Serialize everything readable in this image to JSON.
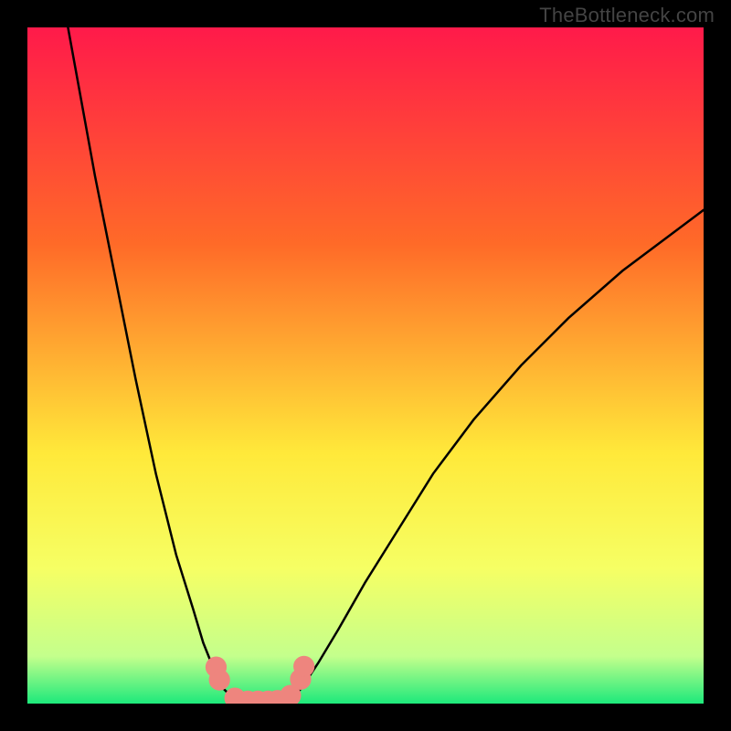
{
  "watermark": "TheBottleneck.com",
  "colors": {
    "bg": "#000000",
    "gradient_top": "#ff1a4a",
    "gradient_upper_mid": "#ff6a28",
    "gradient_mid": "#ffe93a",
    "gradient_lower_mid": "#f6ff64",
    "gradient_near_bottom": "#c4ff8c",
    "gradient_bottom": "#1de97b",
    "curve": "#000000",
    "marker_fill": "#ee857e",
    "marker_stroke": "#ee857e"
  },
  "chart_data": {
    "type": "line",
    "title": "",
    "xlabel": "",
    "ylabel": "",
    "xlim": [
      0,
      100
    ],
    "ylim": [
      0,
      100
    ],
    "series": [
      {
        "name": "curve-left",
        "x": [
          6,
          8,
          10,
          13,
          16,
          19,
          22,
          24.5,
          26,
          27.2,
          28,
          28.5,
          29,
          30,
          31,
          33,
          35
        ],
        "y": [
          100,
          89,
          78,
          63,
          48,
          34,
          22,
          14,
          9,
          6,
          4,
          3,
          2.2,
          1.2,
          0.6,
          0.2,
          0
        ]
      },
      {
        "name": "curve-right",
        "x": [
          35,
          37,
          39,
          40,
          41,
          43,
          46,
          50,
          55,
          60,
          66,
          73,
          80,
          88,
          96,
          100
        ],
        "y": [
          0,
          0.2,
          0.8,
          1.6,
          3,
          6,
          11,
          18,
          26,
          34,
          42,
          50,
          57,
          64,
          70,
          73
        ]
      }
    ],
    "markers": [
      {
        "x": 27.9,
        "y": 5.4,
        "r": 1.5
      },
      {
        "x": 28.4,
        "y": 3.5,
        "r": 1.5
      },
      {
        "x": 30.7,
        "y": 0.8,
        "r": 1.5
      },
      {
        "x": 32.6,
        "y": 0.35,
        "r": 1.5
      },
      {
        "x": 34.1,
        "y": 0.35,
        "r": 1.5
      },
      {
        "x": 35.6,
        "y": 0.35,
        "r": 1.5
      },
      {
        "x": 37.0,
        "y": 0.45,
        "r": 1.5
      },
      {
        "x": 38.9,
        "y": 1.2,
        "r": 1.5
      },
      {
        "x": 40.4,
        "y": 3.6,
        "r": 1.5
      },
      {
        "x": 40.9,
        "y": 5.5,
        "r": 1.5
      }
    ],
    "gradient_stops": [
      {
        "offset": 0.0,
        "color_key": "gradient_top"
      },
      {
        "offset": 0.32,
        "color_key": "gradient_upper_mid"
      },
      {
        "offset": 0.63,
        "color_key": "gradient_mid"
      },
      {
        "offset": 0.8,
        "color_key": "gradient_lower_mid"
      },
      {
        "offset": 0.93,
        "color_key": "gradient_near_bottom"
      },
      {
        "offset": 1.0,
        "color_key": "gradient_bottom"
      }
    ]
  }
}
